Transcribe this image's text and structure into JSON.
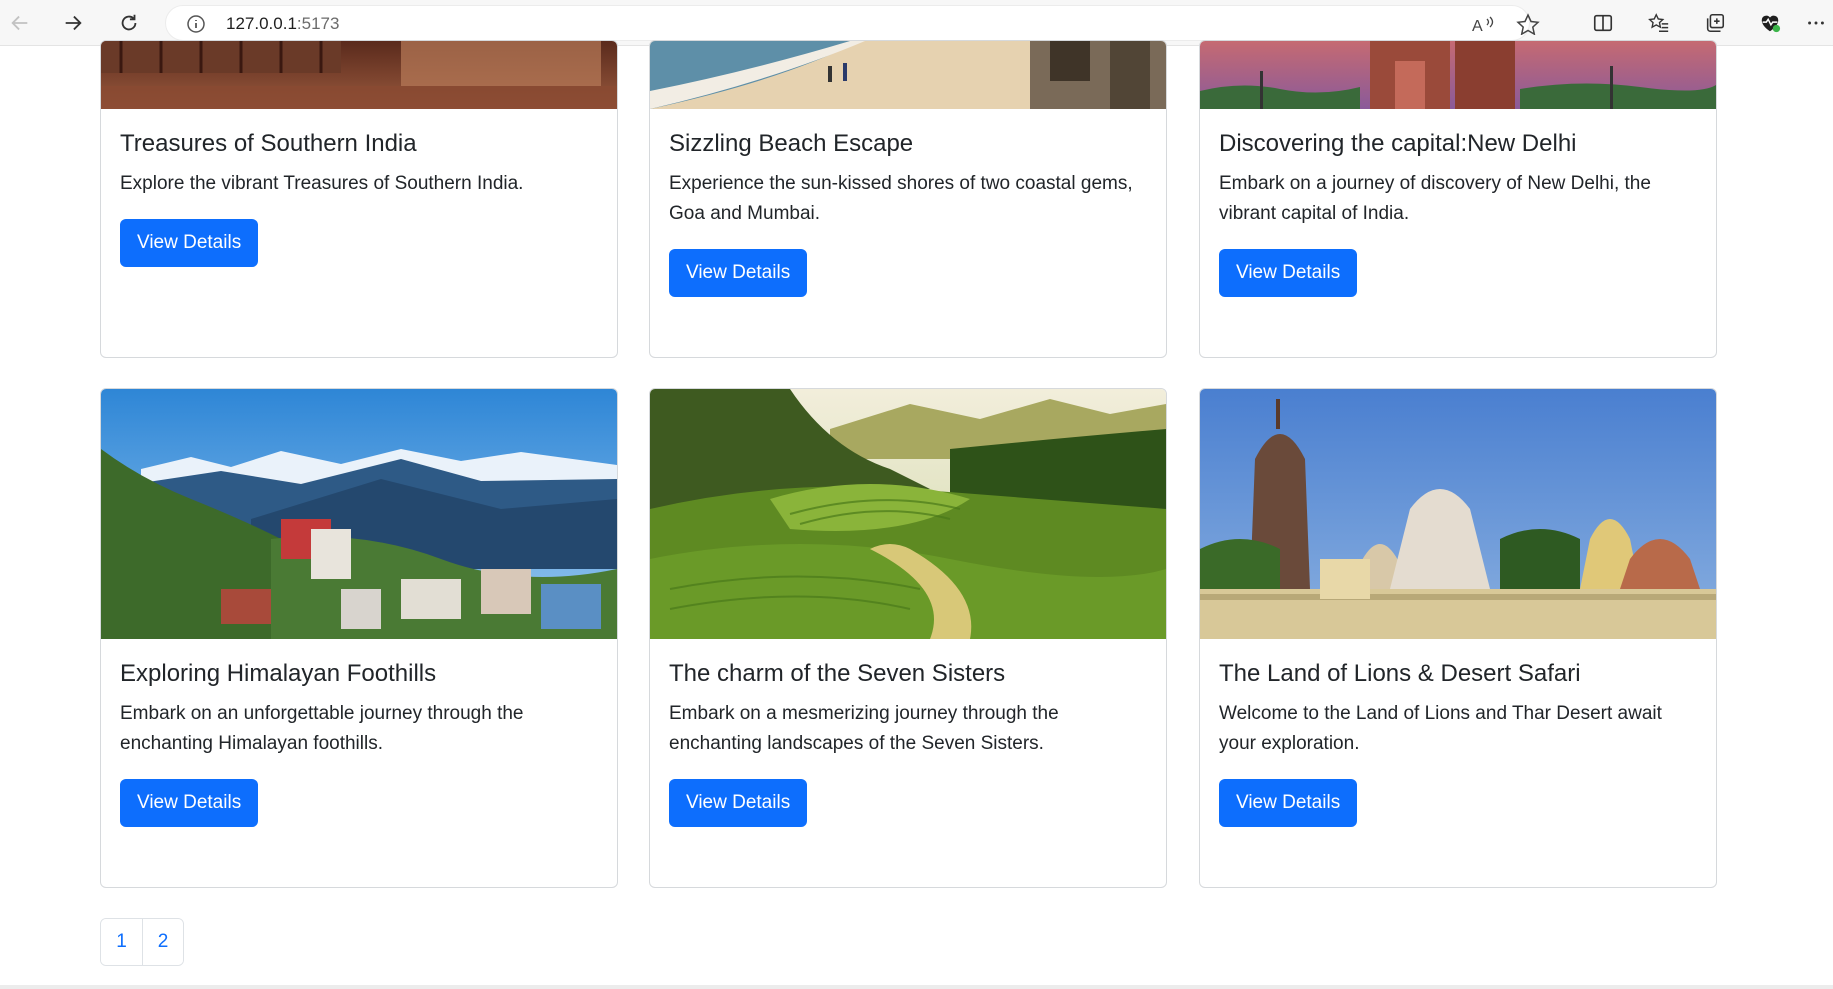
{
  "browser": {
    "url_host": "127.0.0.1",
    "url_port": ":5173",
    "icons": [
      "back-icon",
      "forward-icon",
      "reload-icon",
      "info-icon",
      "read-aloud-icon",
      "favorite-star-icon",
      "split-screen-icon",
      "favorites-icon",
      "collections-icon",
      "performance-icon",
      "more-icon"
    ]
  },
  "cards": [
    {
      "title": "Treasures of Southern India",
      "text": "Explore the vibrant Treasures of Southern India.",
      "button": "View Details"
    },
    {
      "title": "Sizzling Beach Escape",
      "text": "Experience the sun-kissed shores of two coastal gems, Goa and Mumbai.",
      "button": "View Details"
    },
    {
      "title": "Discovering the capital:New Delhi",
      "text": "Embark on a journey of discovery of New Delhi, the vibrant capital of India.",
      "button": "View Details"
    },
    {
      "title": "Exploring Himalayan Foothills",
      "text": "Embark on an unforgettable journey through the enchanting Himalayan foothills.",
      "button": "View Details"
    },
    {
      "title": "The charm of the Seven Sisters",
      "text": "Embark on a mesmerizing journey through the enchanting landscapes of the Seven Sisters.",
      "button": "View Details"
    },
    {
      "title": "The Land of Lions & Desert Safari",
      "text": "Welcome to the Land of Lions and Thar Desert await your exploration.",
      "button": "View Details"
    }
  ],
  "pagination": [
    "1",
    "2"
  ],
  "colors": {
    "primary": "#0d6efd",
    "border": "#d6d9dc"
  }
}
